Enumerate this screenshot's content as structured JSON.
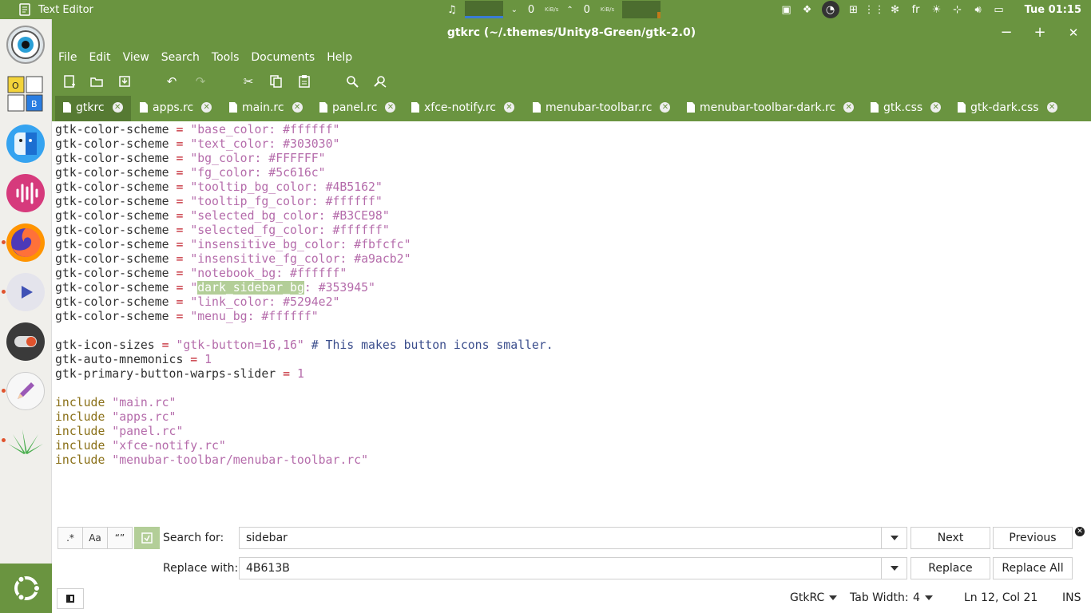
{
  "top_panel": {
    "app_name": "Text Editor",
    "net_down": "0",
    "net_down_unit": "KiB/s",
    "net_up": "0",
    "net_up_unit": "KiB/s",
    "keyboard_layout": "fr",
    "clock": "Tue 01:15"
  },
  "window": {
    "title": "gtkrc (~/.themes/Unity8-Green/gtk-2.0)",
    "minimize": "−",
    "maximize": "+",
    "close": "✕"
  },
  "menubar": [
    "File",
    "Edit",
    "View",
    "Search",
    "Tools",
    "Documents",
    "Help"
  ],
  "tabs": [
    {
      "label": "gtkrc",
      "active": true
    },
    {
      "label": "apps.rc"
    },
    {
      "label": "main.rc"
    },
    {
      "label": "panel.rc"
    },
    {
      "label": "xfce-notify.rc"
    },
    {
      "label": "menubar-toolbar.rc"
    },
    {
      "label": "menubar-toolbar-dark.rc"
    },
    {
      "label": "gtk.css"
    },
    {
      "label": "gtk-dark.css"
    }
  ],
  "editor": {
    "color_scheme_lines": [
      {
        "key": "gtk-color-scheme",
        "op": "=",
        "value": "\"base_color: #ffffff\""
      },
      {
        "key": "gtk-color-scheme",
        "op": "=",
        "value": "\"text_color: #303030\""
      },
      {
        "key": "gtk-color-scheme",
        "op": "=",
        "value": "\"bg_color: #FFFFFF\""
      },
      {
        "key": "gtk-color-scheme",
        "op": "=",
        "value": "\"fg_color: #5c616c\""
      },
      {
        "key": "gtk-color-scheme",
        "op": "=",
        "value": "\"tooltip_bg_color: #4B5162\""
      },
      {
        "key": "gtk-color-scheme",
        "op": "=",
        "value": "\"tooltip_fg_color: #ffffff\""
      },
      {
        "key": "gtk-color-scheme",
        "op": "=",
        "value": "\"selected_bg_color: #B3CE98\""
      },
      {
        "key": "gtk-color-scheme",
        "op": "=",
        "value": "\"selected_fg_color: #ffffff\""
      },
      {
        "key": "gtk-color-scheme",
        "op": "=",
        "value": "\"insensitive_bg_color: #fbfcfc\""
      },
      {
        "key": "gtk-color-scheme",
        "op": "=",
        "value": "\"insensitive_fg_color: #a9acb2\""
      },
      {
        "key": "gtk-color-scheme",
        "op": "=",
        "value": "\"notebook_bg: #ffffff\""
      }
    ],
    "highlight_line": {
      "key": "gtk-color-scheme",
      "op": "=",
      "pre": "\"",
      "match": "dark_sidebar_bg",
      "post": ": #353945\""
    },
    "color_scheme_lines_after": [
      {
        "key": "gtk-color-scheme",
        "op": "=",
        "value": "\"link_color: #5294e2\""
      },
      {
        "key": "gtk-color-scheme",
        "op": "=",
        "value": "\"menu_bg: #ffffff\""
      }
    ],
    "icon_sizes": {
      "key": "gtk-icon-sizes",
      "op": "=",
      "value": "\"gtk-button=16,16\"",
      "comment": "# This makes button icons smaller."
    },
    "mnemonics": {
      "key": "gtk-auto-mnemonics",
      "op": "=",
      "value": "1"
    },
    "warps": {
      "key": "gtk-primary-button-warps-slider",
      "op": "=",
      "value": "1"
    },
    "includes": [
      {
        "kw": "include",
        "file": "\"main.rc\""
      },
      {
        "kw": "include",
        "file": "\"apps.rc\""
      },
      {
        "kw": "include",
        "file": "\"panel.rc\""
      },
      {
        "kw": "include",
        "file": "\"xfce-notify.rc\""
      },
      {
        "kw": "include",
        "file": "\"menubar-toolbar/menubar-toolbar.rc\""
      }
    ]
  },
  "search": {
    "regex_label": ".*",
    "case_label": "Aa",
    "whole_word_label": "“”",
    "search_label": "Search for:",
    "search_value": "sidebar",
    "replace_label": "Replace with:",
    "replace_value": "4B613B",
    "next": "Next",
    "previous": "Previous",
    "replace": "Replace",
    "replace_all": "Replace All"
  },
  "statusbar": {
    "language": "GtkRC",
    "tab_width_label": "Tab Width:",
    "tab_width": "4",
    "position": "Ln 12, Col 21",
    "mode": "INS"
  },
  "colors": {
    "accent": "#6a9440",
    "selection": "#b3ce98",
    "string": "#b56cab",
    "operator": "#c01c28",
    "keyword": "#8a7018",
    "comment": "#3a4d8c"
  }
}
